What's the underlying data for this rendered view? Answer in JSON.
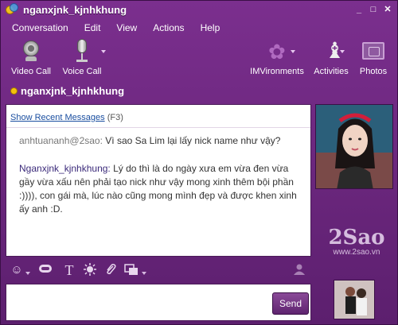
{
  "window": {
    "title": "nganxjnk_kjnhkhung"
  },
  "titlebar_buttons": {
    "minimize": "_",
    "maximize": "□",
    "close": "✕"
  },
  "menu": [
    "Conversation",
    "Edit",
    "View",
    "Actions",
    "Help"
  ],
  "toolbar": {
    "video_call": "Video Call",
    "voice_call": "Voice Call",
    "imvironments": "IMVironments",
    "activities": "Activities",
    "photos": "Photos"
  },
  "contact": {
    "name": "nganxjnk_kjnhkhung",
    "status_color": "#f4c20d"
  },
  "chat": {
    "show_recent": "Show Recent Messages",
    "shortcut": "(F3)",
    "messages": [
      {
        "sender": "anhtuananh@2sao:",
        "text": "Vì sao Sa Lim lại lấy nick name như vậy?"
      },
      {
        "sender": "Nganxjnk_kjnhkhung:",
        "text": "Lý do thì là do ngày xưa em vừa đen vừa gầy vừa xấu nên phải tạo nick như vậy mong xinh thêm bội phần :)))), con gái mà, lúc nào cũng mong mình đẹp và được khen xinh ấy anh :D."
      }
    ]
  },
  "watermark": {
    "logo": "2Sao",
    "url": "www.2sao.vn"
  },
  "send_label": "Send",
  "icons": {
    "emoticon": "☺",
    "text": "T",
    "attach": "📎",
    "share": "⧉",
    "add_contact": "👤"
  },
  "colors": {
    "window_bg": "#6a2a7a",
    "link": "#1a4ea0"
  }
}
